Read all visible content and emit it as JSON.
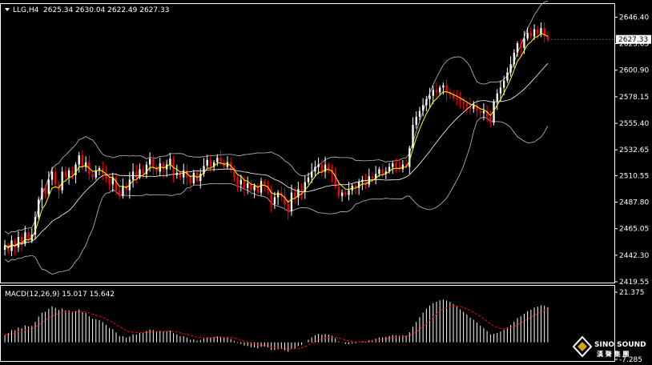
{
  "header": {
    "symbol": "LLG,H4",
    "ohlc": "2625.34 2630.04 2622.49 2627.33"
  },
  "macd_header": {
    "label": "MACD(12,26,9) 15.017 15.642"
  },
  "watermark": {
    "line1": "SINO SOUND",
    "line2": "漢 聲 集 團"
  },
  "colors": {
    "background": "#000000",
    "bull": "#ffffff",
    "bear": "#ff0000",
    "fast_ma": "#ffff00",
    "mid_ma": "#ffffff",
    "bands": "#c0c0c0",
    "macd_hist": "#ffffff",
    "macd_signal": "#ff0000",
    "price_tag_bg": "#ffffff",
    "price_tag_text": "#000000"
  },
  "chart_data": [
    {
      "type": "candlestick",
      "title": "LLG,H4",
      "ylim": [
        2419.55,
        2657.0
      ],
      "y_ticks": [
        "2646.40",
        "2623.65",
        "2600.90",
        "2578.15",
        "2555.40",
        "2532.65",
        "2510.55",
        "2487.80",
        "2465.05",
        "2442.30",
        "2419.55"
      ],
      "current_price": "2627.33",
      "indicators": [
        "Bollinger Bands",
        "Moving Averages"
      ],
      "close": [
        2451,
        2446,
        2455,
        2449,
        2458,
        2452,
        2462,
        2455,
        2460,
        2475,
        2490,
        2500,
        2495,
        2507,
        2514,
        2503,
        2498,
        2514,
        2509,
        2515,
        2511,
        2520,
        2528,
        2518,
        2522,
        2512,
        2509,
        2515,
        2517,
        2512,
        2508,
        2503,
        2509,
        2498,
        2493,
        2502,
        2498,
        2507,
        2514,
        2509,
        2516,
        2512,
        2520,
        2525,
        2518,
        2514,
        2521,
        2516,
        2520,
        2525,
        2511,
        2513,
        2509,
        2515,
        2509,
        2504,
        2513,
        2506,
        2512,
        2519,
        2524,
        2518,
        2522,
        2526,
        2522,
        2518,
        2522,
        2515,
        2509,
        2503,
        2507,
        2500,
        2504,
        2498,
        2502,
        2496,
        2506,
        2502,
        2498,
        2486,
        2492,
        2496,
        2493,
        2486,
        2480,
        2496,
        2492,
        2499,
        2497,
        2505,
        2509,
        2514,
        2518,
        2520,
        2514,
        2520,
        2516,
        2512,
        2501,
        2493,
        2496,
        2494,
        2498,
        2502,
        2500,
        2505,
        2507,
        2503,
        2510,
        2508,
        2512,
        2516,
        2512,
        2514,
        2518,
        2521,
        2518,
        2516,
        2520,
        2518,
        2534,
        2554,
        2561,
        2566,
        2571,
        2576,
        2579,
        2584,
        2582,
        2586,
        2588,
        2582,
        2580,
        2577,
        2576,
        2574,
        2572,
        2570,
        2568,
        2571,
        2566,
        2564,
        2566,
        2561,
        2556,
        2574,
        2581,
        2586,
        2592,
        2599,
        2606,
        2616,
        2624,
        2620,
        2628,
        2633,
        2630,
        2636,
        2632,
        2637,
        2630,
        2627
      ]
    },
    {
      "type": "bar",
      "title": "MACD(12,26,9) 15.017 15.642",
      "ylim": [
        -7.285,
        21.375
      ],
      "y_ticks": [
        "21.375",
        "-7.285"
      ],
      "series": [
        {
          "name": "MACD",
          "values": [
            3.0,
            3.9,
            5.2,
            5.1,
            6.3,
            6.0,
            7.2,
            6.8,
            7.0,
            8.7,
            11.0,
            12.6,
            13.0,
            14.2,
            15.3,
            14.7,
            13.8,
            14.4,
            13.6,
            13.6,
            12.8,
            13.3,
            14.0,
            12.9,
            12.5,
            11.1,
            10.0,
            9.8,
            9.5,
            8.6,
            7.4,
            6.1,
            5.6,
            4.2,
            2.7,
            2.6,
            2.0,
            2.5,
            3.4,
            3.3,
            4.0,
            4.0,
            4.8,
            5.5,
            5.2,
            4.7,
            5.0,
            4.6,
            4.7,
            5.0,
            3.9,
            3.4,
            2.6,
            2.6,
            2.0,
            1.1,
            1.2,
            0.7,
            1.0,
            1.6,
            2.2,
            2.0,
            2.2,
            2.5,
            2.4,
            2.0,
            2.0,
            1.4,
            0.6,
            -0.3,
            -0.7,
            -1.4,
            -1.6,
            -2.1,
            -2.2,
            -2.6,
            -1.9,
            -1.8,
            -2.2,
            -3.3,
            -3.3,
            -3.0,
            -2.9,
            -3.4,
            -4.0,
            -2.8,
            -2.6,
            -1.6,
            -1.1,
            0.1,
            1.1,
            2.1,
            3.0,
            3.6,
            3.2,
            3.5,
            3.3,
            2.8,
            1.6,
            0.4,
            -0.2,
            -0.7,
            -0.8,
            -0.5,
            -0.4,
            0.1,
            0.4,
            0.2,
            0.8,
            1.0,
            1.5,
            2.1,
            2.1,
            2.3,
            2.7,
            3.1,
            3.0,
            2.8,
            3.0,
            2.9,
            4.3,
            6.6,
            8.7,
            10.7,
            12.6,
            14.3,
            15.6,
            16.7,
            17.3,
            17.9,
            18.2,
            17.8,
            17.2,
            16.3,
            15.2,
            14.1,
            13.0,
            11.8,
            10.5,
            9.6,
            8.4,
            7.1,
            6.1,
            4.8,
            3.4,
            3.6,
            4.0,
            4.6,
            5.4,
            6.3,
            7.4,
            8.8,
            10.3,
            11.1,
            12.2,
            13.3,
            13.9,
            14.8,
            15.2,
            15.8,
            15.6,
            15.0
          ]
        },
        {
          "name": "Signal",
          "values": [
            3.2,
            3.3,
            3.7,
            4.0,
            4.5,
            4.8,
            5.3,
            5.6,
            5.9,
            6.5,
            7.4,
            8.5,
            9.4,
            10.4,
            11.3,
            11.9,
            12.3,
            12.7,
            12.9,
            13.0,
            13.0,
            13.0,
            13.2,
            13.1,
            12.9,
            12.5,
            12.0,
            11.5,
            11.1,
            10.6,
            10.0,
            9.2,
            8.5,
            7.6,
            6.6,
            5.8,
            5.0,
            4.5,
            4.3,
            4.1,
            4.1,
            4.1,
            4.2,
            4.5,
            4.6,
            4.6,
            4.7,
            4.7,
            4.7,
            4.8,
            4.6,
            4.3,
            4.0,
            3.7,
            3.3,
            2.9,
            2.6,
            2.2,
            2.0,
            1.9,
            2.0,
            2.0,
            2.0,
            2.1,
            2.2,
            2.2,
            2.2,
            2.1,
            1.8,
            1.4,
            1.0,
            0.5,
            0.1,
            -0.4,
            -0.7,
            -1.1,
            -1.3,
            -1.4,
            -1.6,
            -2.0,
            -2.2,
            -2.4,
            -2.5,
            -2.7,
            -2.9,
            -2.9,
            -2.8,
            -2.6,
            -2.3,
            -1.8,
            -1.2,
            -0.5,
            0.2,
            0.9,
            1.4,
            1.8,
            2.1,
            2.2,
            2.1,
            1.8,
            1.4,
            1.0,
            0.6,
            0.4,
            0.2,
            0.2,
            0.2,
            0.2,
            0.3,
            0.5,
            0.7,
            1.0,
            1.2,
            1.5,
            1.7,
            2.0,
            2.2,
            2.3,
            2.4,
            2.5,
            2.9,
            3.6,
            4.5,
            5.6,
            6.8,
            8.0,
            9.4,
            10.8,
            12.1,
            13.3,
            14.2,
            14.8,
            15.1,
            15.4,
            15.4,
            15.2,
            14.8,
            14.3,
            13.5,
            12.8,
            11.9,
            11.0,
            10.0,
            8.9,
            7.8,
            7.0,
            6.3,
            5.9,
            5.8,
            5.9,
            6.2,
            6.7,
            7.5,
            8.3,
            9.0,
            9.9,
            10.7,
            11.5,
            12.2,
            12.9,
            13.5,
            13.9
          ]
        }
      ]
    }
  ]
}
